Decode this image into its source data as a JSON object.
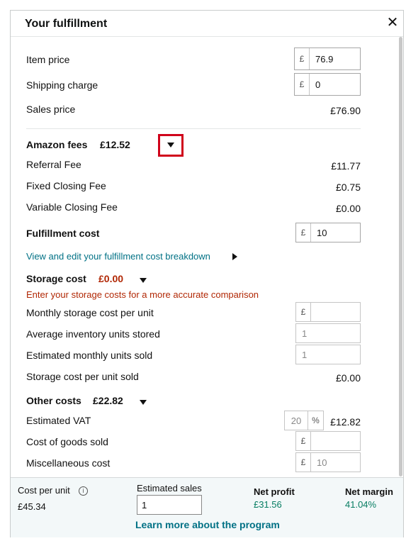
{
  "header": {
    "title": "Your fulfillment",
    "close_icon": "✕"
  },
  "pricing": {
    "item_price_label": "Item price",
    "item_price_currency": "£",
    "item_price_value": "76.9",
    "shipping_label": "Shipping charge",
    "shipping_currency": "£",
    "shipping_value": "0",
    "sales_price_label": "Sales price",
    "sales_price_value": "£76.90"
  },
  "amazon_fees": {
    "title": "Amazon fees",
    "total": "£12.52",
    "referral_label": "Referral Fee",
    "referral_value": "£11.77",
    "fixed_label": "Fixed Closing Fee",
    "fixed_value": "£0.75",
    "variable_label": "Variable Closing Fee",
    "variable_value": "£0.00"
  },
  "fulfillment": {
    "title": "Fulfillment cost",
    "currency": "£",
    "value": "10",
    "breakdown_link": "View and edit your fulfillment cost breakdown"
  },
  "storage": {
    "title": "Storage cost",
    "total": "£0.00",
    "warning": "Enter your storage costs for a more accurate comparison",
    "monthly_label": "Monthly storage cost per unit",
    "monthly_currency": "£",
    "monthly_value": "",
    "avg_label": "Average inventory units stored",
    "avg_value": "1",
    "est_label": "Estimated monthly units sold",
    "est_value": "1",
    "per_unit_label": "Storage cost per unit sold",
    "per_unit_value": "£0.00"
  },
  "other": {
    "title": "Other costs",
    "total": "£22.82",
    "vat_label": "Estimated VAT",
    "vat_value": "20",
    "vat_unit": "%",
    "vat_amount": "£12.82",
    "cogs_label": "Cost of goods sold",
    "cogs_currency": "£",
    "cogs_value": "",
    "misc_label": "Miscellaneous cost",
    "misc_currency": "£",
    "misc_value": "10"
  },
  "footer": {
    "cost_per_unit_label": "Cost per unit",
    "cost_per_unit_value": "£45.34",
    "info_icon": "i",
    "estimated_sales_label": "Estimated sales",
    "estimated_sales_value": "1",
    "net_profit_label": "Net profit",
    "net_profit_value": "£31.56",
    "net_margin_label": "Net margin",
    "net_margin_value": "41.04%",
    "learn_more": "Learn more about the program"
  }
}
